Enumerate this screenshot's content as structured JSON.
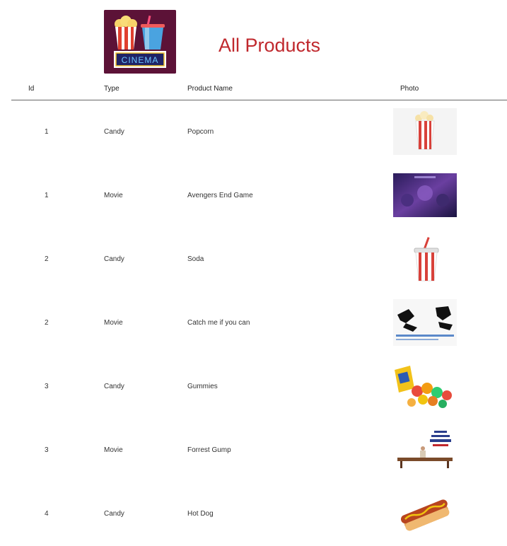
{
  "header": {
    "logo_text": "CINEMA",
    "title": "All Products"
  },
  "table": {
    "columns": [
      "Id",
      "Type",
      "Product Name",
      "Photo"
    ],
    "rows": [
      {
        "id": "1",
        "type": "Candy",
        "name": "Popcorn",
        "photo_icon": "popcorn-photo"
      },
      {
        "id": "1",
        "type": "Movie",
        "name": "Avengers End Game",
        "photo_icon": "avengers-poster-photo"
      },
      {
        "id": "2",
        "type": "Candy",
        "name": "Soda",
        "photo_icon": "soda-cup-photo"
      },
      {
        "id": "2",
        "type": "Movie",
        "name": "Catch me if you can",
        "photo_icon": "catch-me-poster-photo"
      },
      {
        "id": "3",
        "type": "Candy",
        "name": "Gummies",
        "photo_icon": "gummies-photo"
      },
      {
        "id": "3",
        "type": "Movie",
        "name": "Forrest Gump",
        "photo_icon": "forrest-gump-poster-photo"
      },
      {
        "id": "4",
        "type": "Candy",
        "name": "Hot Dog",
        "photo_icon": "hot-dog-photo"
      }
    ]
  },
  "colors": {
    "title": "#c0282d",
    "logo_bg": "#5c1237",
    "rule": "#666666"
  }
}
